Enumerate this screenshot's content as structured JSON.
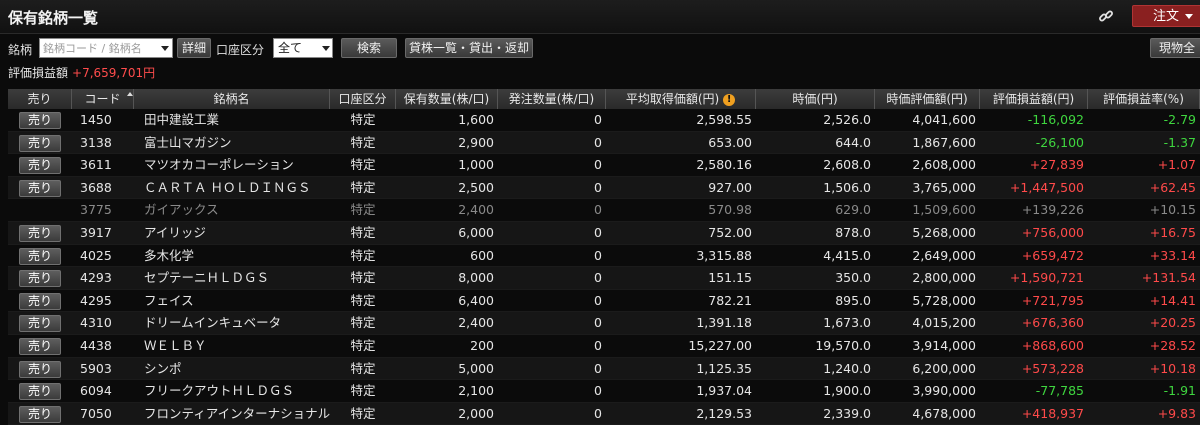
{
  "title": "保有銘柄一覧",
  "order_button": "注文",
  "icons": {
    "link": "link-icon",
    "warning": "warning-icon",
    "sort": "sort-asc-icon"
  },
  "filters": {
    "meigara_label": "銘柄",
    "search_placeholder": "銘柄コード / 銘柄名",
    "detail_button": "詳細",
    "account_label": "口座区分",
    "account_value": "全て",
    "search_button": "検索",
    "lending_button": "貸株一覧・貸出・返却",
    "right_button": "現物全"
  },
  "pnl": {
    "label": "評価損益額",
    "value": "+7,659,701円"
  },
  "colors": {
    "gain": "#ff4a4a",
    "loss": "#3fd63f",
    "order": "#8a2020"
  },
  "table": {
    "headers": [
      "売り",
      "コード",
      "銘柄名",
      "口座区分",
      "保有数量(株/口)",
      "発注数量(株/口)",
      "平均取得価額(円)",
      "時価(円)",
      "時価評価額(円)",
      "評価損益額(円)",
      "評価損益率(%)"
    ],
    "rows": [
      {
        "sell": "売り",
        "code": "1450",
        "name": "田中建設工業",
        "account": "特定",
        "qty": "1,600",
        "order": "0",
        "avg": "2,598.55",
        "price": "2,526.0",
        "value": "4,041,600",
        "pl": "-116,092",
        "rate": "-2.79",
        "dir": "neg",
        "dim": false
      },
      {
        "sell": "売り",
        "code": "3138",
        "name": "富士山マガジン",
        "account": "特定",
        "qty": "2,900",
        "order": "0",
        "avg": "653.00",
        "price": "644.0",
        "value": "1,867,600",
        "pl": "-26,100",
        "rate": "-1.37",
        "dir": "neg",
        "dim": false
      },
      {
        "sell": "売り",
        "code": "3611",
        "name": "マツオカコーポレーション",
        "account": "特定",
        "qty": "1,000",
        "order": "0",
        "avg": "2,580.16",
        "price": "2,608.0",
        "value": "2,608,000",
        "pl": "+27,839",
        "rate": "+1.07",
        "dir": "pos",
        "dim": false
      },
      {
        "sell": "売り",
        "code": "3688",
        "name": "ＣＡＲＴＡ ＨＯＬＤＩＮＧＳ",
        "account": "特定",
        "qty": "2,500",
        "order": "0",
        "avg": "927.00",
        "price": "1,506.0",
        "value": "3,765,000",
        "pl": "+1,447,500",
        "rate": "+62.45",
        "dir": "pos",
        "dim": false
      },
      {
        "sell": "",
        "code": "3775",
        "name": "ガイアックス",
        "account": "特定",
        "qty": "2,400",
        "order": "0",
        "avg": "570.98",
        "price": "629.0",
        "value": "1,509,600",
        "pl": "+139,226",
        "rate": "+10.15",
        "dir": "pos",
        "dim": true
      },
      {
        "sell": "売り",
        "code": "3917",
        "name": "アイリッジ",
        "account": "特定",
        "qty": "6,000",
        "order": "0",
        "avg": "752.00",
        "price": "878.0",
        "value": "5,268,000",
        "pl": "+756,000",
        "rate": "+16.75",
        "dir": "pos",
        "dim": false
      },
      {
        "sell": "売り",
        "code": "4025",
        "name": "多木化学",
        "account": "特定",
        "qty": "600",
        "order": "0",
        "avg": "3,315.88",
        "price": "4,415.0",
        "value": "2,649,000",
        "pl": "+659,472",
        "rate": "+33.14",
        "dir": "pos",
        "dim": false
      },
      {
        "sell": "売り",
        "code": "4293",
        "name": "セプテーニＨＬＤＧＳ",
        "account": "特定",
        "qty": "8,000",
        "order": "0",
        "avg": "151.15",
        "price": "350.0",
        "value": "2,800,000",
        "pl": "+1,590,721",
        "rate": "+131.54",
        "dir": "pos",
        "dim": false
      },
      {
        "sell": "売り",
        "code": "4295",
        "name": "フェイス",
        "account": "特定",
        "qty": "6,400",
        "order": "0",
        "avg": "782.21",
        "price": "895.0",
        "value": "5,728,000",
        "pl": "+721,795",
        "rate": "+14.41",
        "dir": "pos",
        "dim": false
      },
      {
        "sell": "売り",
        "code": "4310",
        "name": "ドリームインキュベータ",
        "account": "特定",
        "qty": "2,400",
        "order": "0",
        "avg": "1,391.18",
        "price": "1,673.0",
        "value": "4,015,200",
        "pl": "+676,360",
        "rate": "+20.25",
        "dir": "pos",
        "dim": false
      },
      {
        "sell": "売り",
        "code": "4438",
        "name": "ＷＥＬＢＹ",
        "account": "特定",
        "qty": "200",
        "order": "0",
        "avg": "15,227.00",
        "price": "19,570.0",
        "value": "3,914,000",
        "pl": "+868,600",
        "rate": "+28.52",
        "dir": "pos",
        "dim": false
      },
      {
        "sell": "売り",
        "code": "5903",
        "name": "シンポ",
        "account": "特定",
        "qty": "5,000",
        "order": "0",
        "avg": "1,125.35",
        "price": "1,240.0",
        "value": "6,200,000",
        "pl": "+573,228",
        "rate": "+10.18",
        "dir": "pos",
        "dim": false
      },
      {
        "sell": "売り",
        "code": "6094",
        "name": "フリークアウトＨＬＤＧＳ",
        "account": "特定",
        "qty": "2,100",
        "order": "0",
        "avg": "1,937.04",
        "price": "1,900.0",
        "value": "3,990,000",
        "pl": "-77,785",
        "rate": "-1.91",
        "dir": "neg",
        "dim": false
      },
      {
        "sell": "売り",
        "code": "7050",
        "name": "フロンティアインターナショナル",
        "account": "特定",
        "qty": "2,000",
        "order": "0",
        "avg": "2,129.53",
        "price": "2,339.0",
        "value": "4,678,000",
        "pl": "+418,937",
        "rate": "+9.83",
        "dir": "pos",
        "dim": false
      }
    ]
  }
}
